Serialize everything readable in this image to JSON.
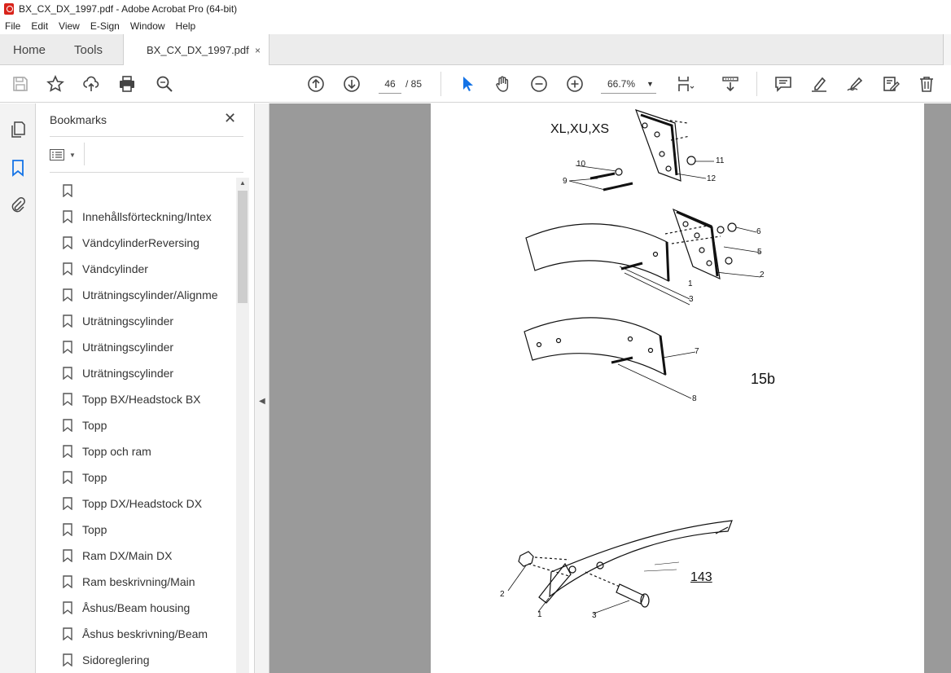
{
  "window": {
    "title": "BX_CX_DX_1997.pdf - Adobe Acrobat Pro (64-bit)"
  },
  "menu": [
    "File",
    "Edit",
    "View",
    "E-Sign",
    "Window",
    "Help"
  ],
  "tabs": {
    "home": "Home",
    "tools": "Tools",
    "document": "BX_CX_DX_1997.pdf",
    "close": "×"
  },
  "toolbar": {
    "current_page": "46",
    "total_pages": "/  85",
    "zoom": "66.7%",
    "icons": [
      "save-icon",
      "star-icon",
      "upload-icon",
      "print-icon",
      "find-icon",
      "prev-page-icon",
      "next-page-icon",
      "select-cursor-icon",
      "hand-icon",
      "zoom-out-icon",
      "zoom-in-icon",
      "page-view-icon",
      "scroll-mode-icon",
      "comment-icon",
      "highlight-icon",
      "sign-icon",
      "edit-icon",
      "delete-icon"
    ]
  },
  "bookmarks": {
    "header": "Bookmarks",
    "close": "✕",
    "items": [
      "",
      "Innehållsförteckning/Intex",
      "VändcylinderReversing",
      "Vändcylinder",
      "Uträtningscylinder/Alignme",
      "Uträtningscylinder",
      "Uträtningscylinder",
      "Uträtningscylinder",
      "Topp BX/Headstock BX",
      "Topp",
      "Topp och ram",
      "Topp",
      "Topp DX/Headstock DX",
      "Topp",
      "Ram DX/Main DX",
      "Ram beskrivning/Main",
      "Åshus/Beam housing",
      "Åshus beskrivning/Beam",
      "Sidoreglering"
    ]
  },
  "page_content": {
    "model_label": "XL,XU,XS",
    "figure_label": "15b",
    "page_number": "143",
    "callouts_top": [
      "10",
      "11",
      "9",
      "12"
    ],
    "callouts_mid": [
      "6",
      "5",
      "2",
      "1",
      "3"
    ],
    "callouts_low": [
      "7",
      "8"
    ],
    "callouts_bottom": [
      "2",
      "1",
      "3"
    ]
  }
}
